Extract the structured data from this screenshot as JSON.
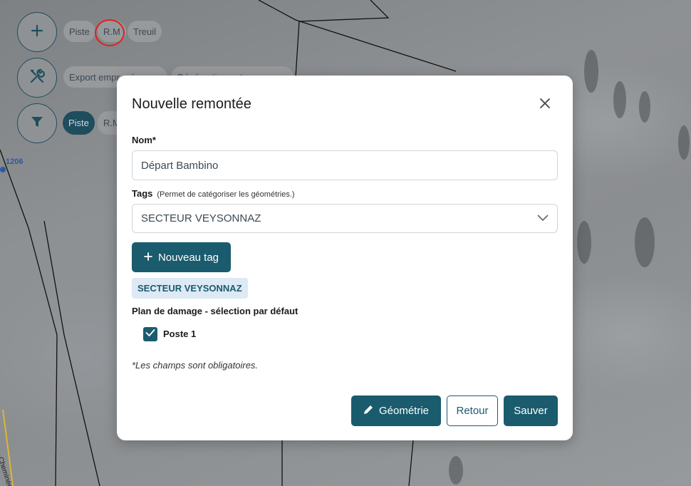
{
  "toolbar": {
    "row1_chips": [
      "Piste",
      "R.M",
      "Treuil"
    ],
    "row2_chips": [
      "Export empr...rés",
      "Géné...ation ... tr..."
    ],
    "row3_chips": [
      "Piste",
      "R.M"
    ]
  },
  "map": {
    "label_altitude": "1206",
    "label_place": "Cheminée"
  },
  "modal": {
    "title": "Nouvelle remontée",
    "name_label": "Nom*",
    "name_value": "Départ Bambino",
    "tags_label": "Tags",
    "tags_hint": "(Permet de catégoriser les géométries.)",
    "tags_selected": "SECTEUR VEYSONNAZ",
    "new_tag_button": "Nouveau tag",
    "tag_pill": "SECTEUR VEYSONNAZ",
    "plan_label": "Plan de damage - sélection par défaut",
    "checkbox_label": "Poste 1",
    "checkbox_checked": true,
    "footnote": "*Les champs sont obligatoires.",
    "geometry_button": "Géométrie",
    "back_button": "Retour",
    "save_button": "Sauver"
  },
  "colors": {
    "primary": "#1a5b6e",
    "tag_bg": "#dde9f4",
    "highlight_ring": "#e02020"
  },
  "icons": {
    "add": "plus-icon",
    "tools": "tools-icon",
    "filter": "filter-icon",
    "close": "close-icon",
    "select": "chevron-down-icon",
    "edit": "pencil-icon",
    "check": "check-icon"
  }
}
